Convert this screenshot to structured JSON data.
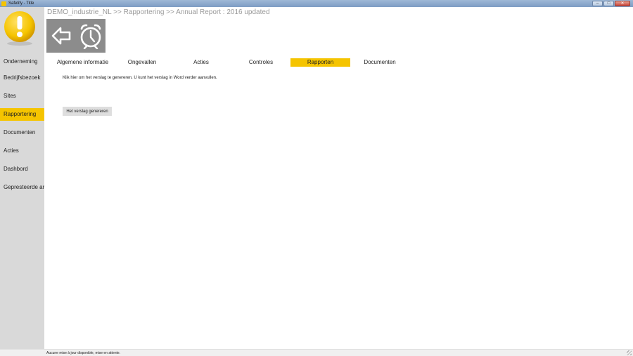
{
  "window": {
    "title": "Safetify - Title",
    "controls": {
      "minimize": "–",
      "maximize": "□",
      "close": "✕"
    }
  },
  "sidebar": {
    "logo_icon": "warning-exclamation-icon",
    "items": [
      {
        "label": "Onderneming",
        "active": false
      },
      {
        "label": "Bedrijfsbezoek",
        "active": false
      },
      {
        "label": "Sites",
        "active": false
      },
      {
        "label": "Rapportering",
        "active": true
      },
      {
        "label": "Documenten",
        "active": false
      },
      {
        "label": "Acties",
        "active": false
      },
      {
        "label": "Dashbord",
        "active": false
      },
      {
        "label": "Gepresteerde arb",
        "active": false
      }
    ]
  },
  "breadcrumb": "DEMO_industrie_NL >> Rapportering >> Annual Report : 2016 updated",
  "toolbar": {
    "back_icon": "back-arrow-icon",
    "timer_icon": "stopwatch-icon"
  },
  "tabs": [
    {
      "label": "Algemene informatie",
      "active": false
    },
    {
      "label": "Ongevallen",
      "active": false
    },
    {
      "label": "Acties",
      "active": false
    },
    {
      "label": "Controles",
      "active": false
    },
    {
      "label": "Rapporten",
      "active": true
    },
    {
      "label": "Documenten",
      "active": false
    }
  ],
  "main": {
    "info_text": "Klik hier om het verslag te genereren. U kunt het verslag in Word verder aanvullen.",
    "generate_button": "Het verslag genereren"
  },
  "status_bar": {
    "message": "Aucune mise à jour disponible, mise en attente."
  },
  "colors": {
    "accent": "#f5c400",
    "sidebar_bg": "#d9d9d9",
    "toolbar_bg": "#8c8c8c"
  }
}
